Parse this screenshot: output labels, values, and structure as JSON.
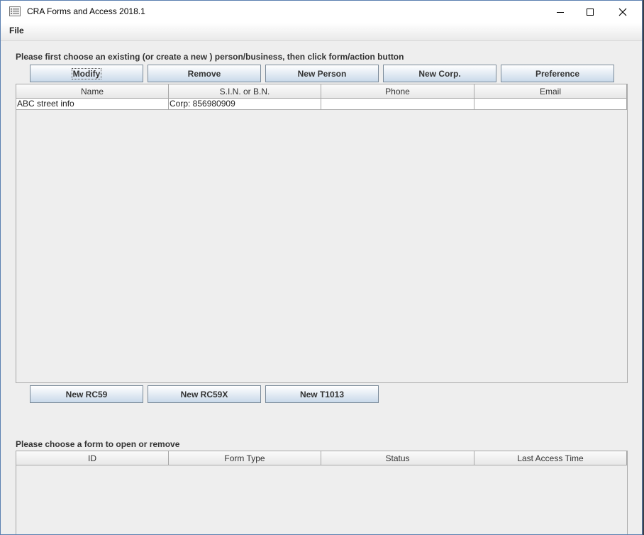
{
  "window": {
    "title": "CRA Forms and Access 2018.1"
  },
  "menu": {
    "file": "File"
  },
  "people": {
    "instruction": "Please first choose an existing (or create a new ) person/business, then click form/action button",
    "buttons": {
      "modify": "Modify",
      "remove": "Remove",
      "new_person": "New Person",
      "new_corp": "New Corp.",
      "preference": "Preference"
    },
    "columns": [
      "Name",
      "S.I.N. or B.N.",
      "Phone",
      "Email"
    ],
    "rows": [
      [
        "ABC street info",
        "Corp: 856980909",
        "",
        ""
      ]
    ]
  },
  "form_actions": {
    "new_rc59": "New RC59",
    "new_rc59x": "New RC59X",
    "new_t1013": "New T1013"
  },
  "forms": {
    "instruction": "Please choose a form to open or remove",
    "columns": [
      "ID",
      "Form Type",
      "Status",
      "Last Access Time"
    ],
    "rows": []
  }
}
